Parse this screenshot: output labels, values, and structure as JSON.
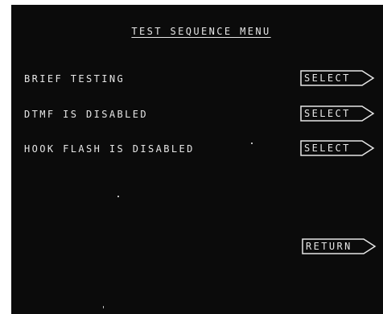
{
  "menu": {
    "title": "TEST SEQUENCE MENU",
    "items": [
      {
        "label": "BRIEF TESTING",
        "action": "SELECT"
      },
      {
        "label": "DTMF IS DISABLED",
        "action": "SELECT"
      },
      {
        "label": "HOOK FLASH IS DISABLED",
        "action": "SELECT"
      }
    ],
    "return_label": "RETURN"
  },
  "colors": {
    "screen_background": "#0b0b0b",
    "text": "#e6e6e6",
    "page_background": "#ffffff"
  }
}
